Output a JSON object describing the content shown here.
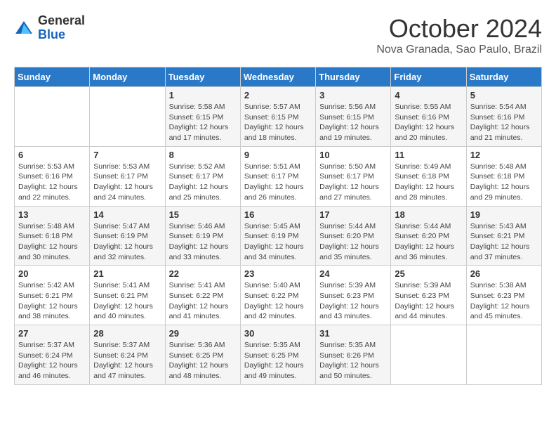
{
  "header": {
    "logo_general": "General",
    "logo_blue": "Blue",
    "month_title": "October 2024",
    "subtitle": "Nova Granada, Sao Paulo, Brazil"
  },
  "weekdays": [
    "Sunday",
    "Monday",
    "Tuesday",
    "Wednesday",
    "Thursday",
    "Friday",
    "Saturday"
  ],
  "weeks": [
    [
      {
        "day": "",
        "info": ""
      },
      {
        "day": "",
        "info": ""
      },
      {
        "day": "1",
        "info": "Sunrise: 5:58 AM\nSunset: 6:15 PM\nDaylight: 12 hours\nand 17 minutes."
      },
      {
        "day": "2",
        "info": "Sunrise: 5:57 AM\nSunset: 6:15 PM\nDaylight: 12 hours\nand 18 minutes."
      },
      {
        "day": "3",
        "info": "Sunrise: 5:56 AM\nSunset: 6:15 PM\nDaylight: 12 hours\nand 19 minutes."
      },
      {
        "day": "4",
        "info": "Sunrise: 5:55 AM\nSunset: 6:16 PM\nDaylight: 12 hours\nand 20 minutes."
      },
      {
        "day": "5",
        "info": "Sunrise: 5:54 AM\nSunset: 6:16 PM\nDaylight: 12 hours\nand 21 minutes."
      }
    ],
    [
      {
        "day": "6",
        "info": "Sunrise: 5:53 AM\nSunset: 6:16 PM\nDaylight: 12 hours\nand 22 minutes."
      },
      {
        "day": "7",
        "info": "Sunrise: 5:53 AM\nSunset: 6:17 PM\nDaylight: 12 hours\nand 24 minutes."
      },
      {
        "day": "8",
        "info": "Sunrise: 5:52 AM\nSunset: 6:17 PM\nDaylight: 12 hours\nand 25 minutes."
      },
      {
        "day": "9",
        "info": "Sunrise: 5:51 AM\nSunset: 6:17 PM\nDaylight: 12 hours\nand 26 minutes."
      },
      {
        "day": "10",
        "info": "Sunrise: 5:50 AM\nSunset: 6:17 PM\nDaylight: 12 hours\nand 27 minutes."
      },
      {
        "day": "11",
        "info": "Sunrise: 5:49 AM\nSunset: 6:18 PM\nDaylight: 12 hours\nand 28 minutes."
      },
      {
        "day": "12",
        "info": "Sunrise: 5:48 AM\nSunset: 6:18 PM\nDaylight: 12 hours\nand 29 minutes."
      }
    ],
    [
      {
        "day": "13",
        "info": "Sunrise: 5:48 AM\nSunset: 6:18 PM\nDaylight: 12 hours\nand 30 minutes."
      },
      {
        "day": "14",
        "info": "Sunrise: 5:47 AM\nSunset: 6:19 PM\nDaylight: 12 hours\nand 32 minutes."
      },
      {
        "day": "15",
        "info": "Sunrise: 5:46 AM\nSunset: 6:19 PM\nDaylight: 12 hours\nand 33 minutes."
      },
      {
        "day": "16",
        "info": "Sunrise: 5:45 AM\nSunset: 6:19 PM\nDaylight: 12 hours\nand 34 minutes."
      },
      {
        "day": "17",
        "info": "Sunrise: 5:44 AM\nSunset: 6:20 PM\nDaylight: 12 hours\nand 35 minutes."
      },
      {
        "day": "18",
        "info": "Sunrise: 5:44 AM\nSunset: 6:20 PM\nDaylight: 12 hours\nand 36 minutes."
      },
      {
        "day": "19",
        "info": "Sunrise: 5:43 AM\nSunset: 6:21 PM\nDaylight: 12 hours\nand 37 minutes."
      }
    ],
    [
      {
        "day": "20",
        "info": "Sunrise: 5:42 AM\nSunset: 6:21 PM\nDaylight: 12 hours\nand 38 minutes."
      },
      {
        "day": "21",
        "info": "Sunrise: 5:41 AM\nSunset: 6:21 PM\nDaylight: 12 hours\nand 40 minutes."
      },
      {
        "day": "22",
        "info": "Sunrise: 5:41 AM\nSunset: 6:22 PM\nDaylight: 12 hours\nand 41 minutes."
      },
      {
        "day": "23",
        "info": "Sunrise: 5:40 AM\nSunset: 6:22 PM\nDaylight: 12 hours\nand 42 minutes."
      },
      {
        "day": "24",
        "info": "Sunrise: 5:39 AM\nSunset: 6:23 PM\nDaylight: 12 hours\nand 43 minutes."
      },
      {
        "day": "25",
        "info": "Sunrise: 5:39 AM\nSunset: 6:23 PM\nDaylight: 12 hours\nand 44 minutes."
      },
      {
        "day": "26",
        "info": "Sunrise: 5:38 AM\nSunset: 6:23 PM\nDaylight: 12 hours\nand 45 minutes."
      }
    ],
    [
      {
        "day": "27",
        "info": "Sunrise: 5:37 AM\nSunset: 6:24 PM\nDaylight: 12 hours\nand 46 minutes."
      },
      {
        "day": "28",
        "info": "Sunrise: 5:37 AM\nSunset: 6:24 PM\nDaylight: 12 hours\nand 47 minutes."
      },
      {
        "day": "29",
        "info": "Sunrise: 5:36 AM\nSunset: 6:25 PM\nDaylight: 12 hours\nand 48 minutes."
      },
      {
        "day": "30",
        "info": "Sunrise: 5:35 AM\nSunset: 6:25 PM\nDaylight: 12 hours\nand 49 minutes."
      },
      {
        "day": "31",
        "info": "Sunrise: 5:35 AM\nSunset: 6:26 PM\nDaylight: 12 hours\nand 50 minutes."
      },
      {
        "day": "",
        "info": ""
      },
      {
        "day": "",
        "info": ""
      }
    ]
  ]
}
